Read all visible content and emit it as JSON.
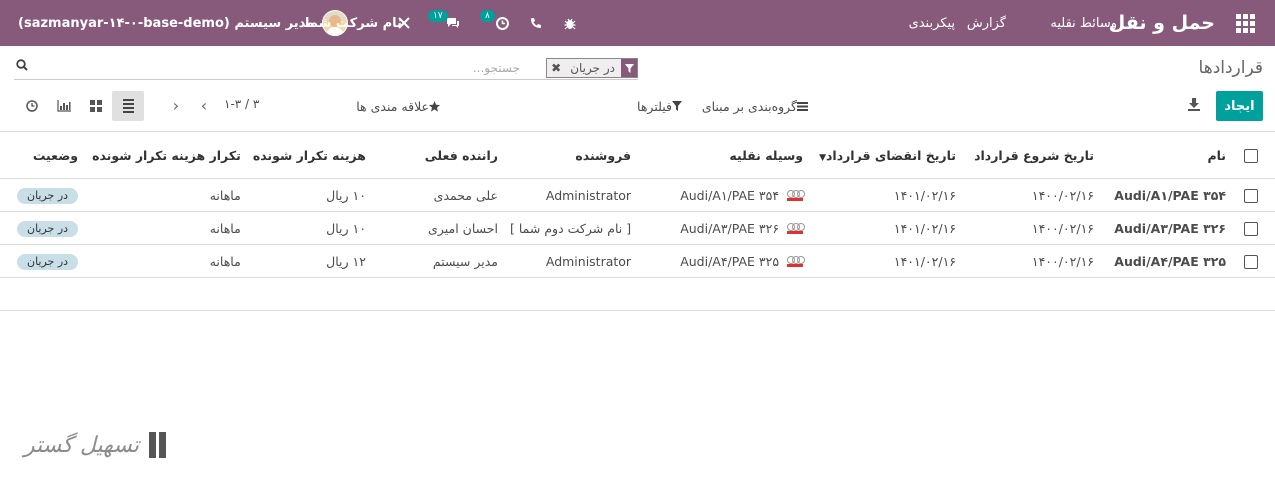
{
  "topbar": {
    "app_title": "حمل و نقل",
    "menu": [
      "وسائط نقلیه",
      "گزارش",
      "پیکربندی"
    ],
    "company": "نام شرکت شما",
    "user": "مدیر سیستم (sazmanyar-۱۴-۰-base-demo)",
    "messages_count": "۱۷",
    "activities_count": "۸",
    "colors": {
      "bar": "#875a7b",
      "badge": "#00a09d"
    }
  },
  "breadcrumb": "قراردادها",
  "search": {
    "facet_value": "در جریان",
    "placeholder": "جستجو..."
  },
  "toolbar": {
    "create_label": "ایجاد",
    "filters_label": "فیلترها",
    "groupby_label": "گروه‌بندی بر مبنای",
    "favorites_label": "علاقه مندی ها",
    "pager": "۱-۳ / ۳"
  },
  "table": {
    "columns": [
      "نام",
      "تاریخ شروع قرارداد",
      "تاریخ انقضای قرارداد",
      "وسیله نقلیه",
      "فروشنده",
      "راننده فعلی",
      "هزینه تکرار شونده",
      "تکرار هزینه تکرار شونده",
      "وضعیت"
    ],
    "rows": [
      {
        "name": "Audi/A۱/PAE ۳۵۴",
        "start": "۱۴۰۰/۰۲/۱۶",
        "expire": "۱۴۰۱/۰۲/۱۶",
        "vehicle": "Audi/A۱/PAE ۳۵۴",
        "vendor": "Administrator",
        "driver": "علی محمدی",
        "cost": "۱۰ ریال",
        "freq": "ماهانه",
        "status": "در جریان"
      },
      {
        "name": "Audi/A۳/PAE ۳۲۶",
        "start": "۱۴۰۰/۰۲/۱۶",
        "expire": "۱۴۰۱/۰۲/۱۶",
        "vehicle": "Audi/A۳/PAE ۳۲۶",
        "vendor": "[ نام شرکت دوم شما ]",
        "driver": "احسان امیری",
        "cost": "۱۰ ریال",
        "freq": "ماهانه",
        "status": "در جریان"
      },
      {
        "name": "Audi/A۴/PAE ۳۲۵",
        "start": "۱۴۰۰/۰۲/۱۶",
        "expire": "۱۴۰۱/۰۲/۱۶",
        "vehicle": "Audi/A۴/PAE ۳۲۵",
        "vendor": "Administrator",
        "driver": "مدیر سیستم",
        "cost": "۱۲ ریال",
        "freq": "ماهانه",
        "status": "در جریان"
      }
    ]
  },
  "watermark": "تسهیل گستر"
}
